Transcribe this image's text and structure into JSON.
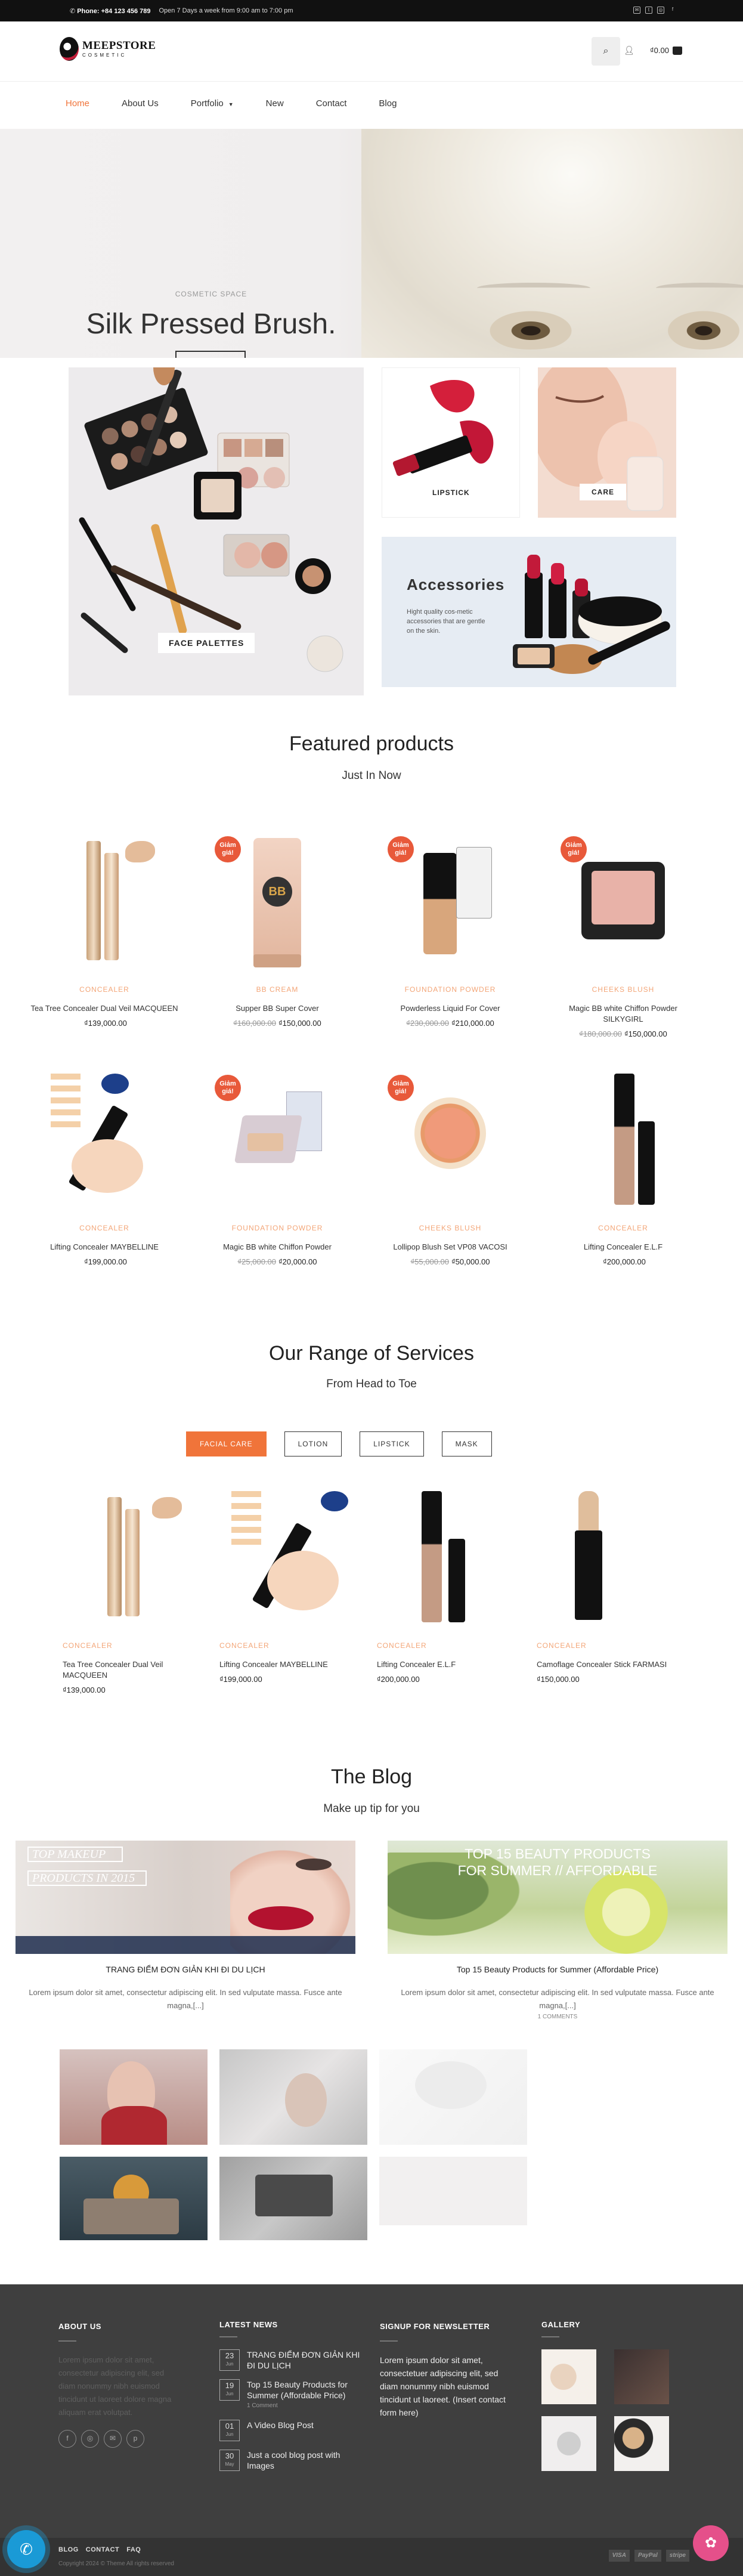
{
  "topbar": {
    "phone": "Phone: +84 123 456 789",
    "hours": "Open 7 Days a week from 9:00 am to 7:00 pm"
  },
  "header": {
    "logo_name": "MEEPSTORE",
    "logo_sub": "COSMETIC",
    "cart_total": "₫0.00"
  },
  "nav": {
    "items": [
      "Home",
      "About Us",
      "Portfolio",
      "New",
      "Contact",
      "Blog"
    ],
    "active": "Home"
  },
  "hero": {
    "kicker": "COSMETIC SPACE",
    "title": "Silk Pressed Brush."
  },
  "banners": {
    "face_palettes": "FACE PALETTES",
    "lipstick": "LIPSTICK",
    "care": "CARE",
    "accessories_title": "Accessories",
    "accessories_text": "Hight quality cos-metic accessories that are gentle on the skin."
  },
  "featured": {
    "title": "Featured products",
    "subtitle": "Just In Now",
    "products": [
      {
        "category": "CONCEALER",
        "name": "Tea Tree Concealer Dual Veil MACQUEEN",
        "old_price": "",
        "price": "₫139,000.00",
        "badge": ""
      },
      {
        "category": "BB CREAM",
        "name": "Supper BB Super Cover",
        "old_price": "₫160,000.00",
        "price": "₫150,000.00",
        "badge": "Giảm giá!"
      },
      {
        "category": "FOUNDATION POWDER",
        "name": "Powderless Liquid For Cover",
        "old_price": "₫230,000.00",
        "price": "₫210,000.00",
        "badge": "Giảm giá!"
      },
      {
        "category": "CHEEKS BLUSH",
        "name": "Magic BB white Chiffon Powder SILKYGIRL",
        "old_price": "₫180,000.00",
        "price": "₫150,000.00",
        "badge": "Giảm giá!"
      },
      {
        "category": "CONCEALER",
        "name": "Lifting Concealer MAYBELLINE",
        "old_price": "",
        "price": "₫199,000.00",
        "badge": ""
      },
      {
        "category": "FOUNDATION POWDER",
        "name": "Magic BB white Chiffon Powder",
        "old_price": "₫25,000.00",
        "price": "₫20,000.00",
        "badge": "Giảm giá!"
      },
      {
        "category": "CHEEKS BLUSH",
        "name": "Lollipop Blush Set VP08 VACOSI",
        "old_price": "₫55,000.00",
        "price": "₫50,000.00",
        "badge": "Giảm giá!"
      },
      {
        "category": "CONCEALER",
        "name": "Lifting Concealer E.L.F",
        "old_price": "",
        "price": "₫200,000.00",
        "badge": ""
      }
    ]
  },
  "services": {
    "title": "Our Range of Services",
    "subtitle": "From Head to Toe",
    "tabs": [
      "FACIAL CARE",
      "LOTION",
      "LIPSTICK",
      "MASK"
    ],
    "products": [
      {
        "category": "CONCEALER",
        "name": "Tea Tree Concealer Dual Veil MACQUEEN",
        "price": "₫139,000.00"
      },
      {
        "category": "CONCEALER",
        "name": "Lifting Concealer MAYBELLINE",
        "price": "₫199,000.00"
      },
      {
        "category": "CONCEALER",
        "name": "Lifting Concealer E.L.F",
        "price": "₫200,000.00"
      },
      {
        "category": "CONCEALER",
        "name": "Camoflage Concealer Stick FARMASI",
        "price": "₫150,000.00"
      }
    ]
  },
  "blog": {
    "title": "The Blog",
    "subtitle": "Make up tip for you",
    "posts": [
      {
        "title": "TRANG ĐIỂM ĐƠN GIẢN KHI ĐI DU LỊCH",
        "excerpt": "Lorem ipsum dolor sit amet, consectetur adipiscing elit. In sed vulputate massa. Fusce ante magna,[...]",
        "comments": "",
        "overlay1": "TOP MAKEUP",
        "overlay2": "PRODUCTS IN 2015"
      },
      {
        "title": "Top 15 Beauty Products for Summer (Affordable Price)",
        "excerpt": "Lorem ipsum dolor sit amet, consectetur adipiscing elit. In sed vulputate massa. Fusce ante magna,[...]",
        "comments": "1 COMMENTS",
        "overlay1": "TOP 15 BEAUTY PRODUCTS",
        "overlay2": "FOR SUMMER // AFFORDABLE"
      }
    ]
  },
  "footer": {
    "about_title": "ABOUT US",
    "about_text": "Lorem ipsum dolor sit amet, consectetur adipiscing elit, sed diam nonummy nibh euismod tincidunt ut laoreet dolore magna aliquam erat volutpat.",
    "news_title": "LATEST NEWS",
    "news": [
      {
        "day": "23",
        "month": "Jun",
        "title": "TRANG ĐIỂM ĐƠN GIẢN KHI ĐI DU LỊCH",
        "comments": ""
      },
      {
        "day": "19",
        "month": "Jun",
        "title": "Top 15 Beauty Products for Summer (Affordable Price)",
        "comments": "1 Comment"
      },
      {
        "day": "01",
        "month": "Jun",
        "title": "A Video Blog Post",
        "comments": ""
      },
      {
        "day": "30",
        "month": "May",
        "title": "Just a cool blog post with Images",
        "comments": ""
      }
    ],
    "newsletter_title": "SIGNUP FOR NEWSLETTER",
    "newsletter_text": "Lorem ipsum dolor sit amet, consectetuer adipiscing elit, sed diam nonummy nibh euismod tincidunt ut laoreet. (Insert contact form here)",
    "gallery_title": "GALLERY",
    "bottom_links": [
      "BLOG",
      "CONTACT",
      "FAQ"
    ],
    "copyright": "Copyright 2024 © Theme All rights reserved",
    "payments": [
      "VISA",
      "PayPal",
      "stripe"
    ]
  },
  "colors": {
    "accent": "#f0743a",
    "category": "#f3a577",
    "badge": "#e8593a",
    "footer": "#3f3f3f"
  }
}
